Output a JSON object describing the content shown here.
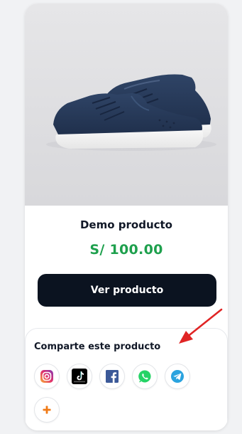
{
  "product": {
    "name": "Demo producto",
    "price": "S/ 100.00",
    "button_label": "Ver producto"
  },
  "share": {
    "title": "Comparte este producto",
    "networks": [
      {
        "id": "instagram",
        "icon": "instagram-icon"
      },
      {
        "id": "tiktok",
        "icon": "tiktok-icon"
      },
      {
        "id": "facebook",
        "icon": "facebook-icon"
      },
      {
        "id": "whatsapp",
        "icon": "whatsapp-icon"
      },
      {
        "id": "telegram",
        "icon": "telegram-icon"
      },
      {
        "id": "more",
        "icon": "plus-icon"
      }
    ]
  },
  "colors": {
    "price": "#1ea04d",
    "button_bg": "#0b1320",
    "arrow": "#e02424",
    "plus": "#f07a16"
  }
}
